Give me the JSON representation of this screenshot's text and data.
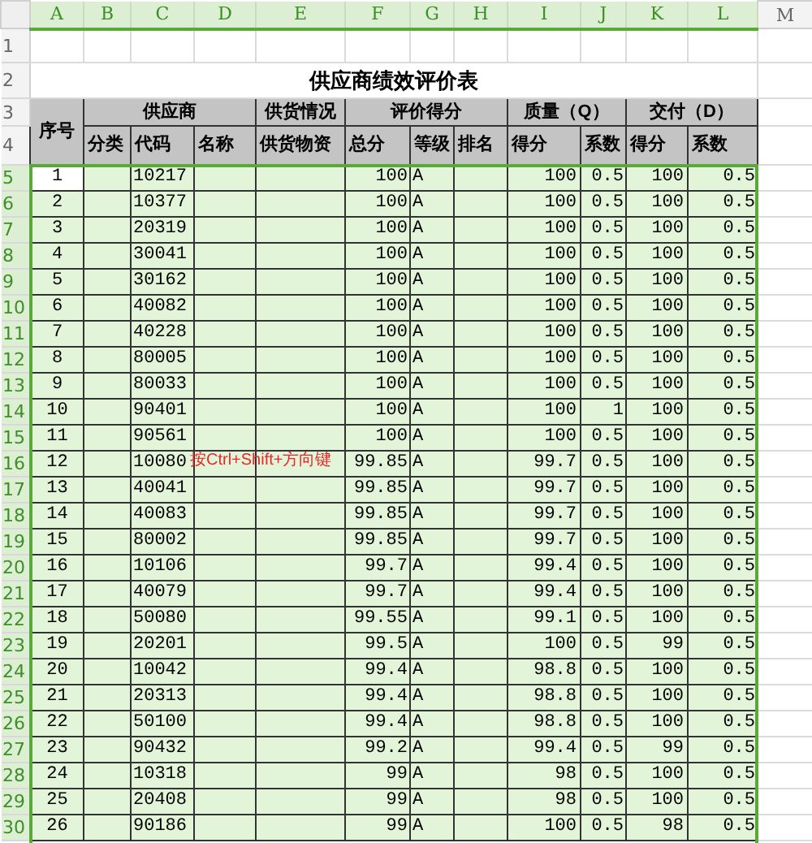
{
  "column_headers": [
    {
      "label": "A",
      "selected": true
    },
    {
      "label": "B",
      "selected": true
    },
    {
      "label": "C",
      "selected": true
    },
    {
      "label": "D",
      "selected": true
    },
    {
      "label": "E",
      "selected": true
    },
    {
      "label": "F",
      "selected": true
    },
    {
      "label": "G",
      "selected": true
    },
    {
      "label": "H",
      "selected": true
    },
    {
      "label": "I",
      "selected": true
    },
    {
      "label": "J",
      "selected": true
    },
    {
      "label": "K",
      "selected": true
    },
    {
      "label": "L",
      "selected": true
    },
    {
      "label": "M",
      "selected": false
    }
  ],
  "empty_row": {
    "row_number": "1",
    "selected": false
  },
  "title_row": {
    "row_number": "2",
    "selected": false,
    "title": "供应商绩效评价表"
  },
  "header_rows": [
    {
      "row_number": "3",
      "selected": false
    },
    {
      "row_number": "4",
      "selected": false
    }
  ],
  "group_headers": [
    "序号",
    "供应商",
    "供货情况",
    "评价得分",
    "质量（Q）",
    "交付（D）"
  ],
  "sub_headers": [
    "分类",
    "代码",
    "名称",
    "供货物资",
    "总分",
    "等级",
    "排名",
    "得分",
    "系数",
    "得分",
    "系数"
  ],
  "data_rows": [
    {
      "row_number": "5",
      "selected": true,
      "active": true,
      "no": "1",
      "code": "10217",
      "total": "100",
      "grade": "A",
      "q_score": "100",
      "q_coef": "0.5",
      "d_score": "100",
      "d_coef": "0.5"
    },
    {
      "row_number": "6",
      "selected": true,
      "active": false,
      "no": "2",
      "code": "10377",
      "total": "100",
      "grade": "A",
      "q_score": "100",
      "q_coef": "0.5",
      "d_score": "100",
      "d_coef": "0.5"
    },
    {
      "row_number": "7",
      "selected": true,
      "active": false,
      "no": "3",
      "code": "20319",
      "total": "100",
      "grade": "A",
      "q_score": "100",
      "q_coef": "0.5",
      "d_score": "100",
      "d_coef": "0.5"
    },
    {
      "row_number": "8",
      "selected": true,
      "active": false,
      "no": "4",
      "code": "30041",
      "total": "100",
      "grade": "A",
      "q_score": "100",
      "q_coef": "0.5",
      "d_score": "100",
      "d_coef": "0.5"
    },
    {
      "row_number": "9",
      "selected": true,
      "active": false,
      "no": "5",
      "code": "30162",
      "total": "100",
      "grade": "A",
      "q_score": "100",
      "q_coef": "0.5",
      "d_score": "100",
      "d_coef": "0.5"
    },
    {
      "row_number": "10",
      "selected": true,
      "active": false,
      "no": "6",
      "code": "40082",
      "total": "100",
      "grade": "A",
      "q_score": "100",
      "q_coef": "0.5",
      "d_score": "100",
      "d_coef": "0.5"
    },
    {
      "row_number": "11",
      "selected": true,
      "active": false,
      "no": "7",
      "code": "40228",
      "total": "100",
      "grade": "A",
      "q_score": "100",
      "q_coef": "0.5",
      "d_score": "100",
      "d_coef": "0.5"
    },
    {
      "row_number": "12",
      "selected": true,
      "active": false,
      "no": "8",
      "code": "80005",
      "total": "100",
      "grade": "A",
      "q_score": "100",
      "q_coef": "0.5",
      "d_score": "100",
      "d_coef": "0.5"
    },
    {
      "row_number": "13",
      "selected": true,
      "active": false,
      "no": "9",
      "code": "80033",
      "total": "100",
      "grade": "A",
      "q_score": "100",
      "q_coef": "0.5",
      "d_score": "100",
      "d_coef": "0.5"
    },
    {
      "row_number": "14",
      "selected": true,
      "active": false,
      "no": "10",
      "code": "90401",
      "total": "100",
      "grade": "A",
      "q_score": "100",
      "q_coef": "1",
      "d_score": "100",
      "d_coef": "0.5"
    },
    {
      "row_number": "15",
      "selected": true,
      "active": false,
      "no": "11",
      "code": "90561",
      "total": "100",
      "grade": "A",
      "q_score": "100",
      "q_coef": "0.5",
      "d_score": "100",
      "d_coef": "0.5"
    },
    {
      "row_number": "16",
      "selected": true,
      "active": false,
      "no": "12",
      "code": "10080",
      "total": "99.85",
      "grade": "A",
      "q_score": "99.7",
      "q_coef": "0.5",
      "d_score": "100",
      "d_coef": "0.5"
    },
    {
      "row_number": "17",
      "selected": true,
      "active": false,
      "no": "13",
      "code": "40041",
      "total": "99.85",
      "grade": "A",
      "q_score": "99.7",
      "q_coef": "0.5",
      "d_score": "100",
      "d_coef": "0.5"
    },
    {
      "row_number": "18",
      "selected": true,
      "active": false,
      "no": "14",
      "code": "40083",
      "total": "99.85",
      "grade": "A",
      "q_score": "99.7",
      "q_coef": "0.5",
      "d_score": "100",
      "d_coef": "0.5"
    },
    {
      "row_number": "19",
      "selected": true,
      "active": false,
      "no": "15",
      "code": "80002",
      "total": "99.85",
      "grade": "A",
      "q_score": "99.7",
      "q_coef": "0.5",
      "d_score": "100",
      "d_coef": "0.5"
    },
    {
      "row_number": "20",
      "selected": true,
      "active": false,
      "no": "16",
      "code": "10106",
      "total": "99.7",
      "grade": "A",
      "q_score": "99.4",
      "q_coef": "0.5",
      "d_score": "100",
      "d_coef": "0.5"
    },
    {
      "row_number": "21",
      "selected": true,
      "active": false,
      "no": "17",
      "code": "40079",
      "total": "99.7",
      "grade": "A",
      "q_score": "99.4",
      "q_coef": "0.5",
      "d_score": "100",
      "d_coef": "0.5"
    },
    {
      "row_number": "22",
      "selected": true,
      "active": false,
      "no": "18",
      "code": "50080",
      "total": "99.55",
      "grade": "A",
      "q_score": "99.1",
      "q_coef": "0.5",
      "d_score": "100",
      "d_coef": "0.5"
    },
    {
      "row_number": "23",
      "selected": true,
      "active": false,
      "no": "19",
      "code": "20201",
      "total": "99.5",
      "grade": "A",
      "q_score": "100",
      "q_coef": "0.5",
      "d_score": "99",
      "d_coef": "0.5"
    },
    {
      "row_number": "24",
      "selected": true,
      "active": false,
      "no": "20",
      "code": "10042",
      "total": "99.4",
      "grade": "A",
      "q_score": "98.8",
      "q_coef": "0.5",
      "d_score": "100",
      "d_coef": "0.5"
    },
    {
      "row_number": "25",
      "selected": true,
      "active": false,
      "no": "21",
      "code": "20313",
      "total": "99.4",
      "grade": "A",
      "q_score": "98.8",
      "q_coef": "0.5",
      "d_score": "100",
      "d_coef": "0.5"
    },
    {
      "row_number": "26",
      "selected": true,
      "active": false,
      "no": "22",
      "code": "50100",
      "total": "99.4",
      "grade": "A",
      "q_score": "98.8",
      "q_coef": "0.5",
      "d_score": "100",
      "d_coef": "0.5"
    },
    {
      "row_number": "27",
      "selected": true,
      "active": false,
      "no": "23",
      "code": "90432",
      "total": "99.2",
      "grade": "A",
      "q_score": "99.4",
      "q_coef": "0.5",
      "d_score": "99",
      "d_coef": "0.5"
    },
    {
      "row_number": "28",
      "selected": true,
      "active": false,
      "no": "24",
      "code": "10318",
      "total": "99",
      "grade": "A",
      "q_score": "98",
      "q_coef": "0.5",
      "d_score": "100",
      "d_coef": "0.5"
    },
    {
      "row_number": "29",
      "selected": true,
      "active": false,
      "no": "25",
      "code": "20408",
      "total": "99",
      "grade": "A",
      "q_score": "98",
      "q_coef": "0.5",
      "d_score": "100",
      "d_coef": "0.5"
    },
    {
      "row_number": "30",
      "selected": true,
      "active": false,
      "no": "26",
      "code": "90186",
      "total": "99",
      "grade": "A",
      "q_score": "100",
      "q_coef": "0.5",
      "d_score": "98",
      "d_coef": "0.5"
    }
  ],
  "annotation": {
    "text": "按Ctrl+Shift+方向键"
  }
}
